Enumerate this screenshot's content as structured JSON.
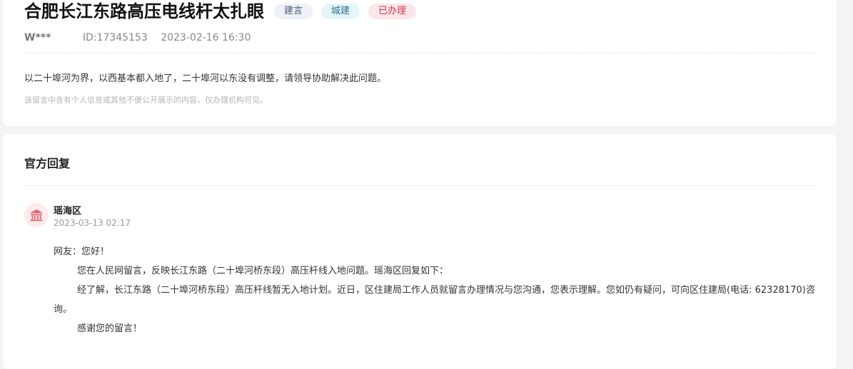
{
  "post": {
    "title": "合肥长江东路高压电线杆太扎眼",
    "tags": {
      "type": "建言",
      "category": "城建",
      "status": "已办理"
    },
    "user": "W***",
    "id": "ID:17345153",
    "datetime": "2023-02-16 16:30",
    "content": "以二十埠河为界，以西基本都入地了，二十埠河以东没有调整，请领导协助解决此问题。",
    "privacy_note": "该留言中含有个人信息或其他不便公开展示的内容，仅办理机构可见。"
  },
  "reply": {
    "heading": "官方回复",
    "org_name": "瑶海区",
    "org_icon": "government-building-icon",
    "datetime": "2023-03-13 02:17",
    "greeting": "网友：您好！",
    "para1": "您在人民网留言，反映长江东路（二十埠河桥东段）高压杆线入地问题。瑶海区回复如下：",
    "para2": "经了解，长江东路（二十埠河桥东段）高压杆线暂无入地计划。近日，区住建局工作人员就留言办理情况与您沟通，您表示理解。您如仍有疑问，可向区住建局(电话: 62328170)咨询。",
    "closing": "感谢您的留言！"
  },
  "colors": {
    "status_red": "#d0394d",
    "category_blue": "#2f6f91",
    "avatar_bg": "#fdebec",
    "avatar_icon": "#e0646e"
  }
}
